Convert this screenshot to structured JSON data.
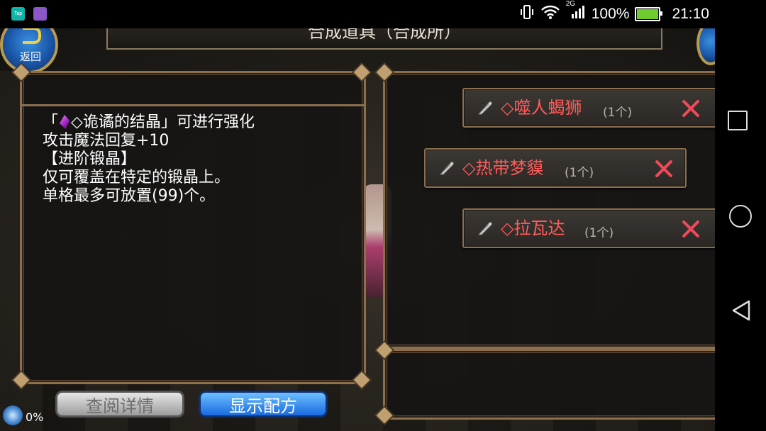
{
  "status_bar": {
    "apps": [
      "Tap",
      ""
    ],
    "battery_text": "100%",
    "battery_level": 1.0,
    "network": "2G",
    "time": "21:10"
  },
  "header": {
    "title": "合成道具（合成所）",
    "back_label": "返回"
  },
  "description": {
    "lines": [
      "「◇诡谲的结晶」可进行强化",
      "攻击魔法回复+10",
      "",
      "【进阶锻晶】",
      "仅可覆盖在特定的锻晶上。",
      "单格最多可放置(99)个。"
    ],
    "crystal_name": "◇诡谲的结晶",
    "crystal_icon": "purple-crystal-icon"
  },
  "recipe_items": [
    {
      "name": "◇噬人蝎狮",
      "count": "(1个)",
      "icon": "feather-icon"
    },
    {
      "name": "◇热带梦貘",
      "count": "(1个)",
      "icon": "feather-icon"
    },
    {
      "name": "◇拉瓦达",
      "count": "(1个)",
      "icon": "feather-icon"
    }
  ],
  "buttons": {
    "details": "查阅详情",
    "show_recipe": "显示配方"
  },
  "download_progress": "0%",
  "colors": {
    "item_name": "#ff5c5c",
    "remove_x": "#f04a5a",
    "panel_border": "#8b6f4e",
    "button_blue": "#1a6ae0"
  }
}
